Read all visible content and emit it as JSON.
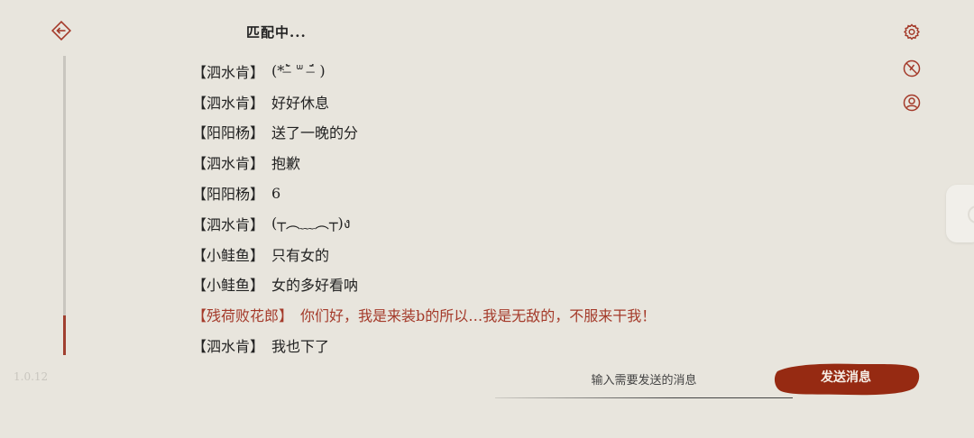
{
  "header": {
    "title": "匹配中..."
  },
  "app": {
    "version": "1.0.12"
  },
  "messages": [
    {
      "name": "【泗水肯】",
      "text": "(*ˉ̶̀ ᐜ ˉ̶́ )"
    },
    {
      "name": "【泗水肯】",
      "text": "好好休息"
    },
    {
      "name": "【阳阳杨】",
      "text": "送了一晚的分"
    },
    {
      "name": "【泗水肯】",
      "text": "抱歉"
    },
    {
      "name": "【阳阳杨】",
      "text": "6"
    },
    {
      "name": "【泗水肯】",
      "text": "(┬︵﹏︵┬)ง"
    },
    {
      "name": "【小鲑鱼】",
      "text": "只有女的"
    },
    {
      "name": "【小鲑鱼】",
      "text": "女的多好看呐"
    },
    {
      "name": "【残荷败花郎】",
      "text": "你们好，我是来装b的所以…我是无敌的，不服来干我！"
    },
    {
      "name": "【泗水肯】",
      "text": "我也下了"
    }
  ],
  "composer": {
    "placeholder": "输入需要发送的消息",
    "send_label": "发送消息"
  },
  "colors": {
    "accent": "#a43a2a",
    "background": "#e8e5dd",
    "send_button": "#962a12"
  },
  "icons": {
    "back": "back-arrow-icon",
    "settings": "gear-icon",
    "no_pk": "no-versus-icon",
    "profile": "user-icon"
  }
}
